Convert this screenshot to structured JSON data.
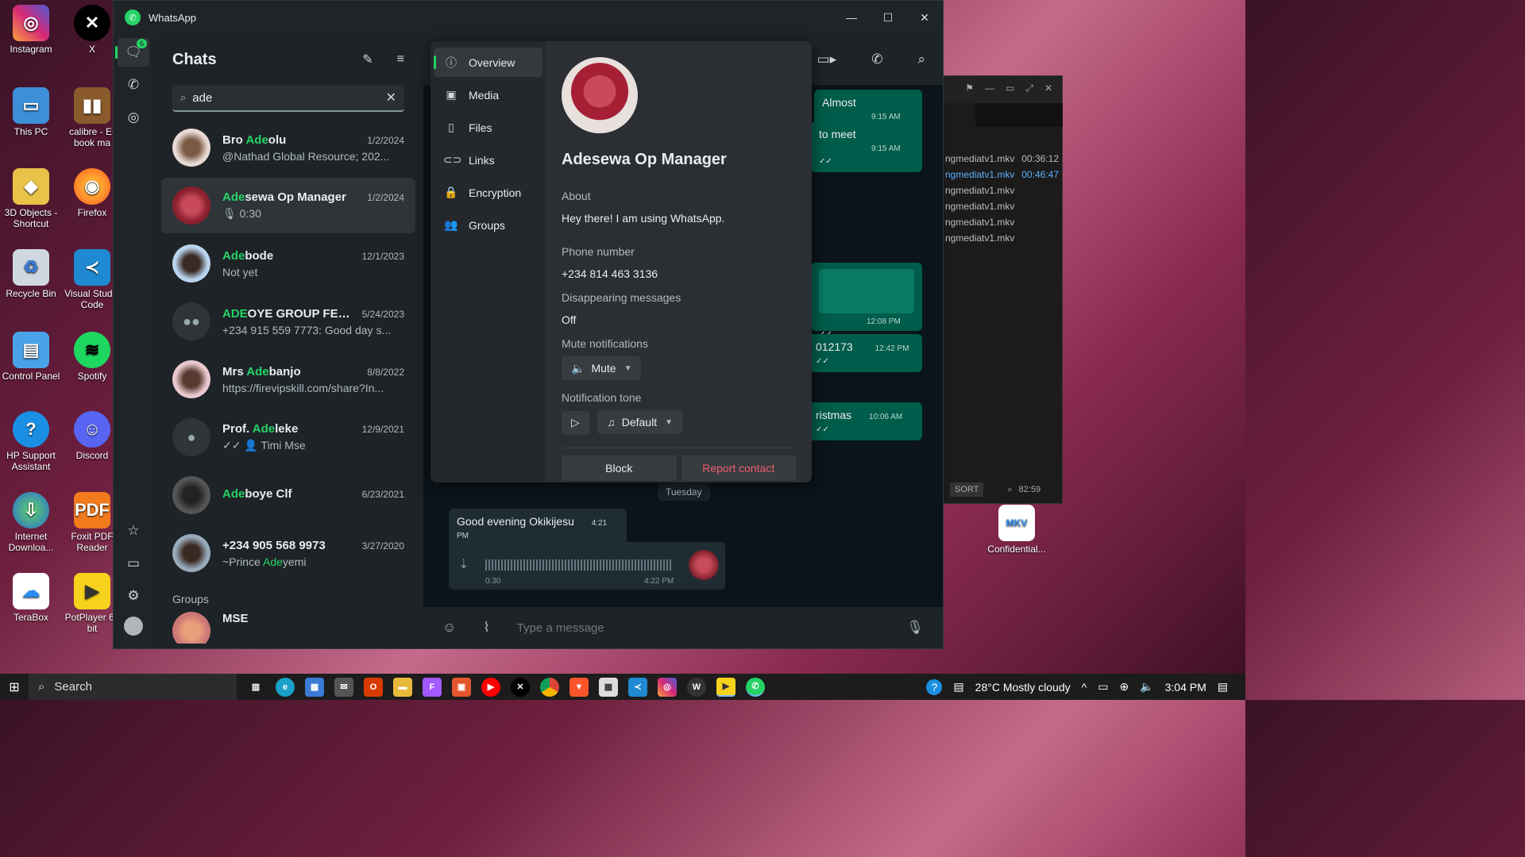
{
  "desktop": {
    "icons": [
      {
        "label": "Instagram",
        "x": 0,
        "y": 0
      },
      {
        "label": "X"
      },
      {
        "label": "This PC"
      },
      {
        "label": "calibre - E-book ma"
      },
      {
        "label": "3D Objects - Shortcut"
      },
      {
        "label": "Firefox"
      },
      {
        "label": "Recycle Bin"
      },
      {
        "label": "Visual Studio Code"
      },
      {
        "label": "Control Panel"
      },
      {
        "label": "Spotify"
      },
      {
        "label": "HP Support Assistant"
      },
      {
        "label": "Discord"
      },
      {
        "label": "Internet Downloa..."
      },
      {
        "label": "Foxit PDF Reader"
      },
      {
        "label": "TeraBox"
      },
      {
        "label": "PotPlayer 64 bit"
      },
      {
        "label": "Confidential..."
      }
    ]
  },
  "bg_window": {
    "files": [
      {
        "name": "ngmediatv1.mkv",
        "dur": "00:36:12"
      },
      {
        "name": "ngmediatv1.mkv",
        "dur": "00:46:47"
      },
      {
        "name": "ngmediatv1.mkv",
        "dur": ""
      },
      {
        "name": "ngmediatv1.mkv",
        "dur": ""
      },
      {
        "name": "ngmediatv1.mkv",
        "dur": ""
      },
      {
        "name": "ngmediatv1.mkv",
        "dur": ""
      }
    ],
    "sort_label": "SORT",
    "time": "82:59"
  },
  "window": {
    "title": "WhatsApp"
  },
  "rail": {
    "chats_badge": "6"
  },
  "chatlist": {
    "title": "Chats",
    "search_value": "ade",
    "chats": [
      {
        "pre": "Bro ",
        "hl": "Ade",
        "post": "olu",
        "date": "1/2/2024",
        "preview": "@Nathad Global Resource; 202..."
      },
      {
        "pre": "",
        "hl": "Ade",
        "post": "sewa Op Manager",
        "date": "1/2/2024",
        "preview": "🎙 0:30"
      },
      {
        "pre": "",
        "hl": "Ade",
        "post": "bode",
        "date": "12/1/2023",
        "preview": "Not yet"
      },
      {
        "pre": "",
        "hl": "ADE",
        "post": "OYE GROUP FED...",
        "date": "5/24/2023",
        "preview": "+234 915 559 7773: Good day s..."
      },
      {
        "pre": "Mrs ",
        "hl": "Ade",
        "post": "banjo",
        "date": "8/8/2022",
        "preview": "https://firevipskill.com/share?In..."
      },
      {
        "pre": "Prof. ",
        "hl": "Ade",
        "post": "leke",
        "date": "12/9/2021",
        "preview": "✓✓ 👤 Timi Mse"
      },
      {
        "pre": "",
        "hl": "Ade",
        "post": "boye Clf",
        "date": "6/23/2021",
        "preview": ""
      },
      {
        "pre": "+234 905 568 9973",
        "hl": "",
        "post": "",
        "date": "3/27/2020",
        "preview_pre": "~Prince ",
        "preview_hl": "Ade",
        "preview_post": "yemi"
      }
    ],
    "groups_label": "Groups",
    "group_first": "MSE"
  },
  "conversation": {
    "bubbles": [
      {
        "text": "Almost",
        "time": "9:15 AM"
      },
      {
        "text": "to meet",
        "time": "9:15 AM"
      },
      {
        "text": "",
        "time": "12:08 PM"
      },
      {
        "text": "012173",
        "time": "12:42 PM"
      },
      {
        "text": "ristmas",
        "time": "10:06 AM"
      }
    ],
    "day_chip": "Tuesday",
    "incoming": {
      "text": "Good evening Okikijesu",
      "time": "4:21 PM"
    },
    "voice": {
      "duration": "0:30",
      "time": "4:22 PM"
    },
    "composer_placeholder": "Type a message"
  },
  "info": {
    "nav": [
      "Overview",
      "Media",
      "Files",
      "Links",
      "Encryption",
      "Groups"
    ],
    "name": "Adesewa Op Manager",
    "about_label": "About",
    "about_value": "Hey there! I am using WhatsApp.",
    "phone_label": "Phone number",
    "phone_value": "+234 814 463 3136",
    "disappearing_label": "Disappearing messages",
    "disappearing_value": "Off",
    "mute_label": "Mute notifications",
    "mute_button": "Mute",
    "tone_label": "Notification tone",
    "tone_value": "Default",
    "block_label": "Block",
    "report_label": "Report contact"
  },
  "taskbar": {
    "search_label": "Search",
    "weather": "28°C  Mostly cloudy",
    "time": "3:04 PM"
  }
}
